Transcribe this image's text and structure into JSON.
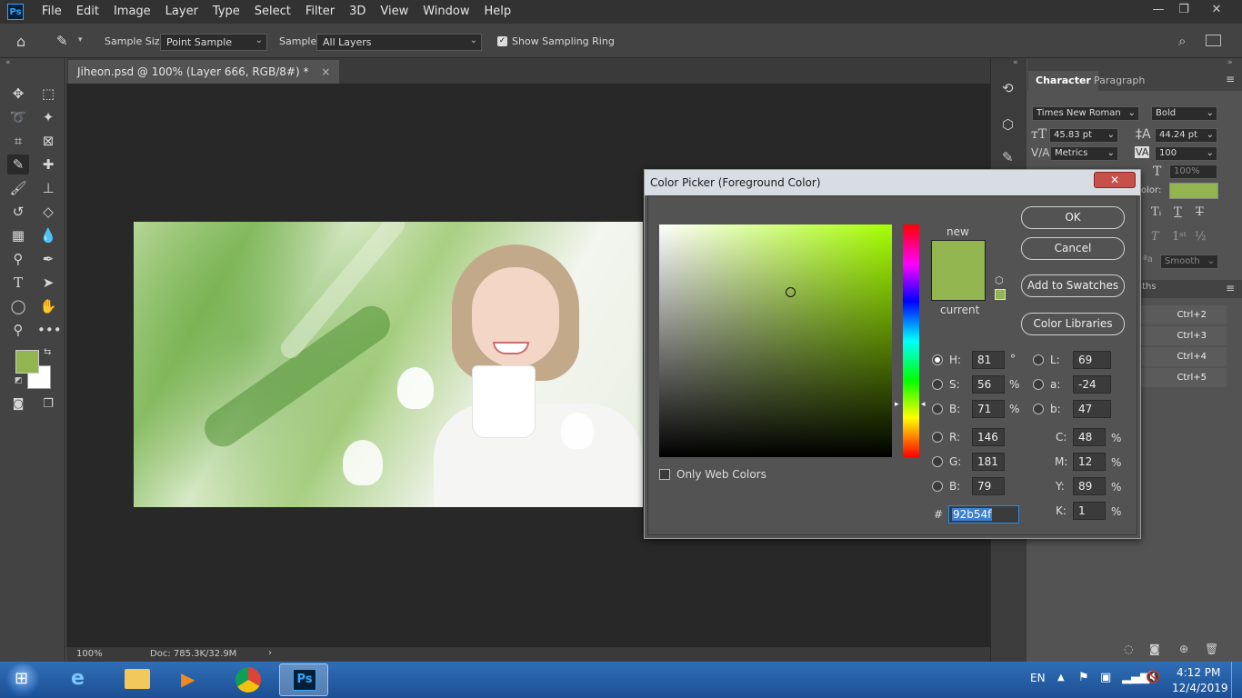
{
  "app": {
    "menu": [
      "File",
      "Edit",
      "Image",
      "Layer",
      "Type",
      "Select",
      "Filter",
      "3D",
      "View",
      "Window",
      "Help"
    ],
    "logo_text": "Ps",
    "window_controls": [
      "—",
      "❐",
      "✕"
    ]
  },
  "options_bar": {
    "sample_size_label": "Sample Size:",
    "sample_size_value": "Point Sample",
    "sample_label": "Sample:",
    "sample_value": "All Layers",
    "show_sampling_ring_label": "Show Sampling Ring",
    "show_sampling_ring_checked": true
  },
  "document": {
    "tab_title": "Jiheon.psd @ 100% (Layer 666, RGB/8#) *",
    "tab_close": "×",
    "zoom": "100%",
    "doc_info": "Doc: 785.3K/32.9M"
  },
  "toolbar": {
    "foreground_color": "#92b54f",
    "background_color": "#ffffff"
  },
  "character_panel": {
    "tabs": [
      "Character",
      "Paragraph"
    ],
    "font_family": "Times New Roman",
    "font_style": "Bold",
    "font_size": "45.83 pt",
    "leading": "44.24 pt",
    "kerning": "Metrics",
    "tracking": "100",
    "vertical_scale": "100%",
    "color_label": "olor:",
    "color_swatch": "#92b54f",
    "antialias": "Smooth",
    "second_tab_partial": "aths",
    "shortcuts": [
      "Ctrl+2",
      "Ctrl+3",
      "Ctrl+4",
      "Ctrl+5"
    ]
  },
  "color_picker": {
    "title": "Color Picker (Foreground Color)",
    "new_label": "new",
    "current_label": "current",
    "new_color": "#92b54f",
    "current_color": "#92b54f",
    "buttons": {
      "ok": "OK",
      "cancel": "Cancel",
      "add_to_swatches": "Add to Swatches",
      "color_libraries": "Color Libraries"
    },
    "only_web_colors_label": "Only Web Colors",
    "only_web_colors_checked": false,
    "hsb": {
      "H": "81",
      "S": "56",
      "B": "71",
      "H_unit": "°",
      "S_unit": "%",
      "B_unit": "%"
    },
    "lab": {
      "L": "69",
      "a": "-24",
      "b": "47"
    },
    "rgb": {
      "R": "146",
      "G": "181",
      "B": "79"
    },
    "cmyk": {
      "C": "48",
      "M": "12",
      "Y": "89",
      "K": "1",
      "unit": "%"
    },
    "hex_label": "#",
    "hex": "92b54f",
    "selected_channel": "H"
  },
  "taskbar": {
    "language": "EN",
    "time": "4:12 PM",
    "date": "12/4/2019"
  }
}
